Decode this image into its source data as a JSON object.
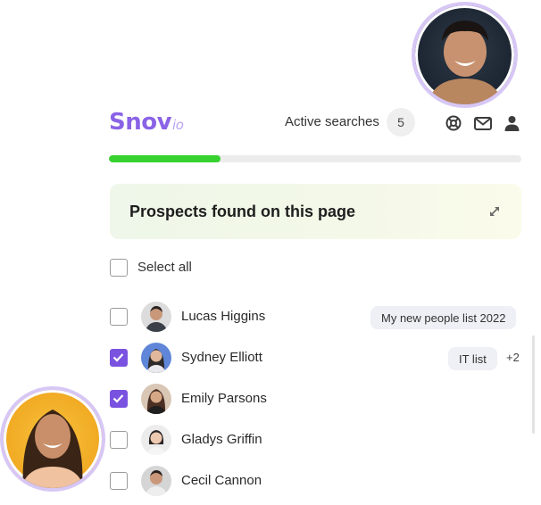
{
  "header": {
    "logo_main": "Snov",
    "logo_suffix": "io",
    "active_searches_label": "Active searches",
    "active_searches_count": "5",
    "icons": [
      "support-icon",
      "mail-icon",
      "user-icon"
    ]
  },
  "progress": {
    "fraction": 0.27,
    "color": "#38d230"
  },
  "banner": {
    "title": "Prospects found on this page"
  },
  "select_all": {
    "label": "Select all",
    "checked": false
  },
  "prospects": [
    {
      "name": "Lucas Higgins",
      "checked": false,
      "tags": [
        "My new people list 2022"
      ],
      "more": ""
    },
    {
      "name": "Sydney Elliott",
      "checked": true,
      "tags": [
        "IT list"
      ],
      "more": "+2"
    },
    {
      "name": "Emily Parsons",
      "checked": true,
      "tags": [],
      "more": ""
    },
    {
      "name": "Gladys Griffin",
      "checked": false,
      "tags": [],
      "more": ""
    },
    {
      "name": "Cecil Cannon",
      "checked": false,
      "tags": [],
      "more": ""
    }
  ],
  "colors": {
    "brand": "#8a63e6",
    "check": "#7a52e0",
    "ring": "#d7c7f5"
  }
}
